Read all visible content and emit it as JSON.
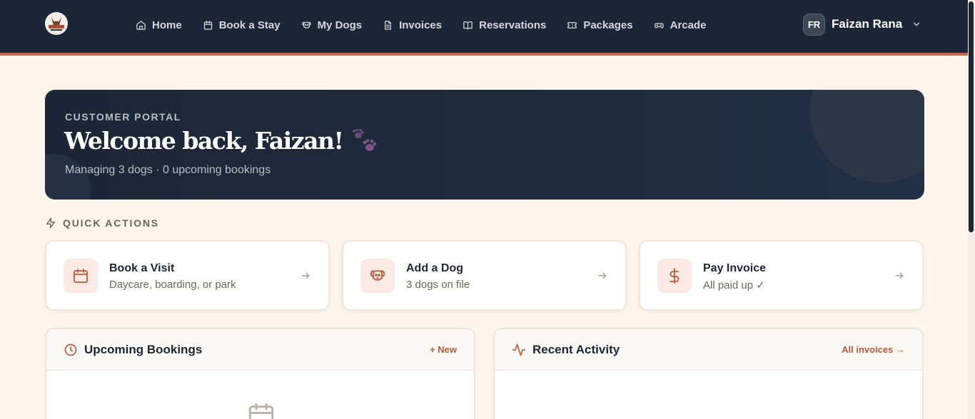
{
  "header": {
    "nav": [
      {
        "label": "Home",
        "icon": "home-icon"
      },
      {
        "label": "Book a Stay",
        "icon": "calendar-icon"
      },
      {
        "label": "My Dogs",
        "icon": "dog-icon"
      },
      {
        "label": "Invoices",
        "icon": "document-icon"
      },
      {
        "label": "Reservations",
        "icon": "book-icon"
      },
      {
        "label": "Packages",
        "icon": "ticket-icon"
      },
      {
        "label": "Arcade",
        "icon": "gamepad-icon"
      }
    ],
    "user": {
      "initials": "FR",
      "name": "Faizan Rana"
    }
  },
  "hero": {
    "eyebrow": "CUSTOMER PORTAL",
    "title": "Welcome back, Faizan!",
    "subtitle": "Managing 3 dogs · 0 upcoming bookings"
  },
  "quick_actions": {
    "heading": "QUICK ACTIONS",
    "items": [
      {
        "title": "Book a Visit",
        "subtitle": "Daycare, boarding, or park",
        "icon": "calendar-icon"
      },
      {
        "title": "Add a Dog",
        "subtitle": "3 dogs on file",
        "icon": "dog-icon"
      },
      {
        "title": "Pay Invoice",
        "subtitle": "All paid up ✓",
        "icon": "dollar-icon"
      }
    ]
  },
  "panels": {
    "upcoming": {
      "title": "Upcoming Bookings",
      "link": "+ New"
    },
    "activity": {
      "title": "Recent Activity",
      "link": "All invoices →"
    }
  },
  "colors": {
    "header_bg": "#1c2636",
    "accent": "#c9674a",
    "page_bg": "#fdf5ec",
    "link": "#c0583a"
  }
}
